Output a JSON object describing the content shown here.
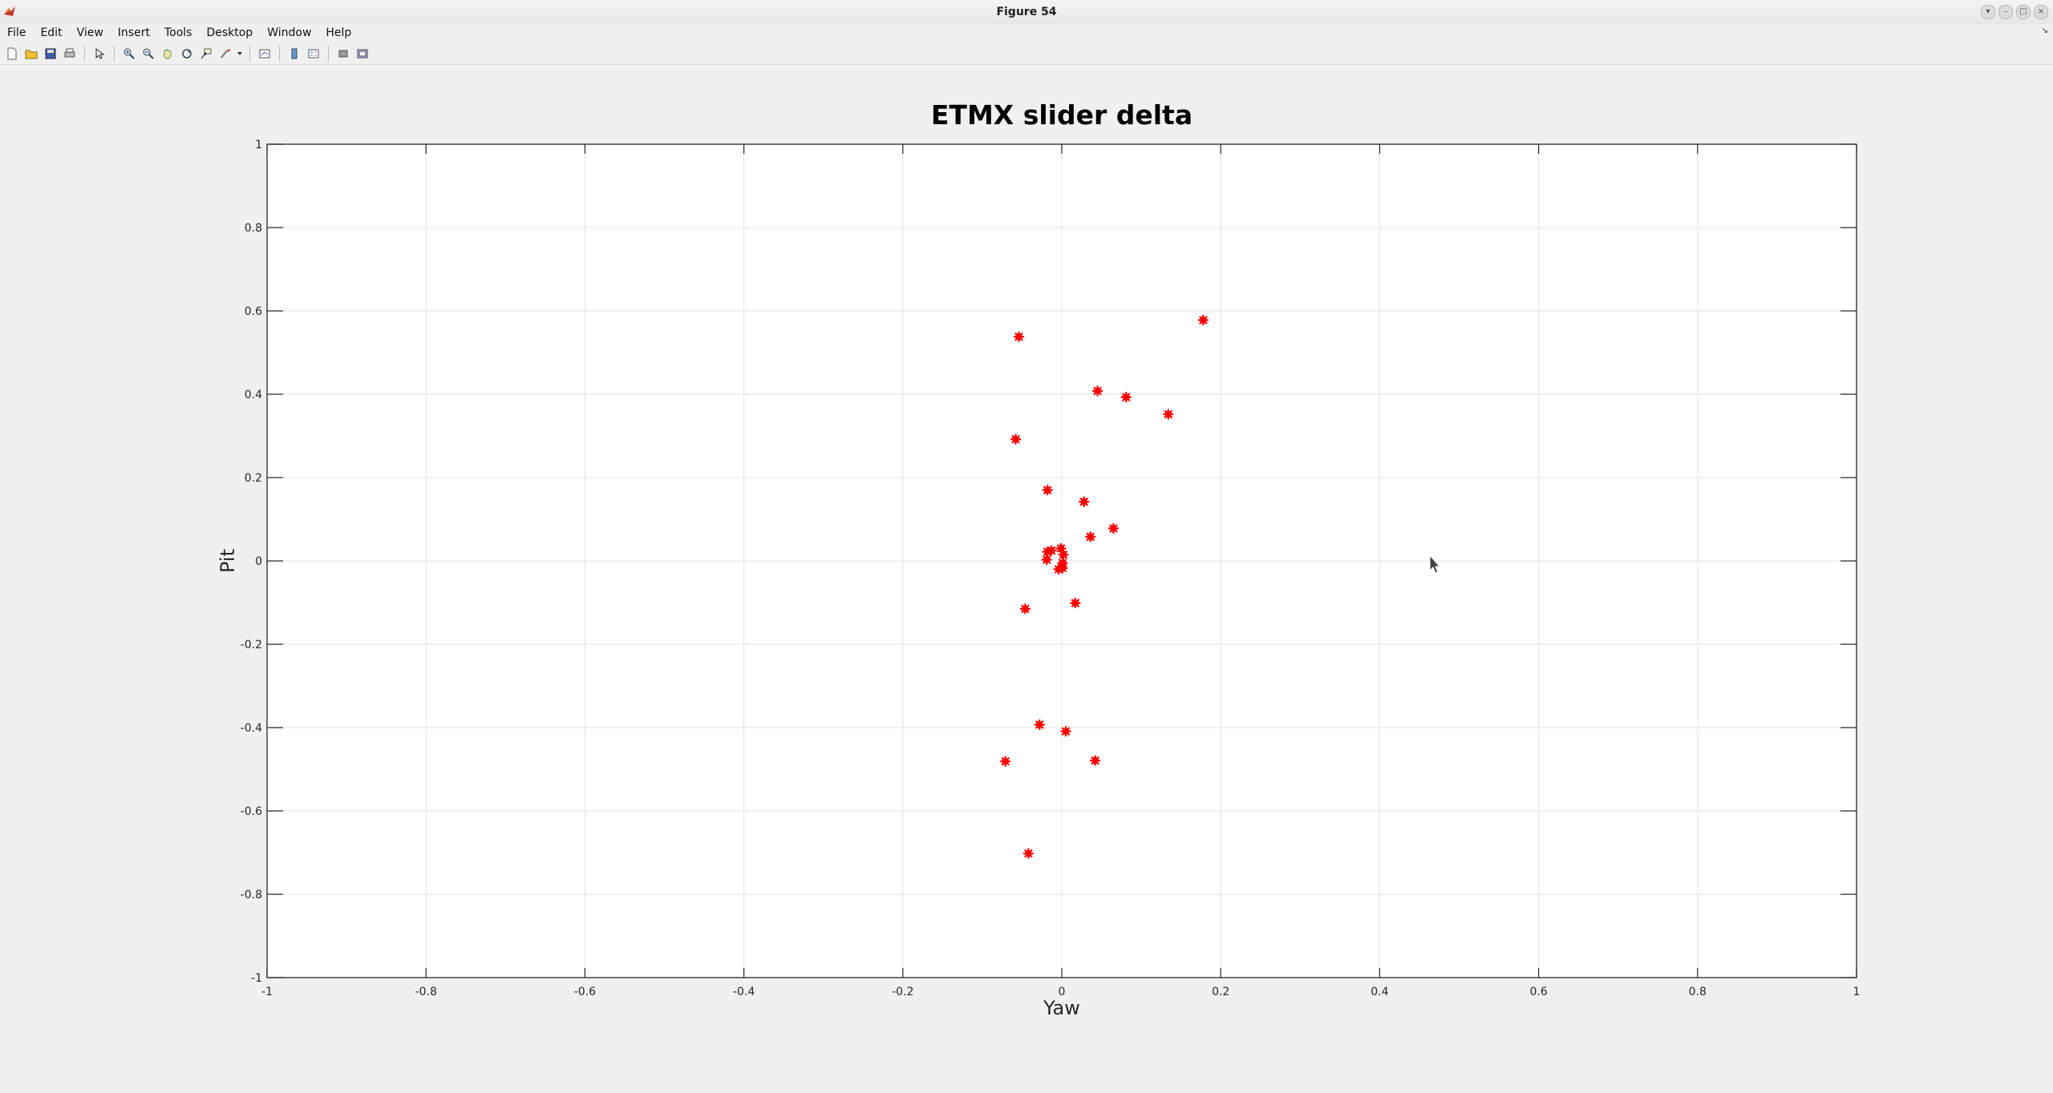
{
  "window": {
    "title": "Figure 54"
  },
  "menu": {
    "items": [
      "File",
      "Edit",
      "View",
      "Insert",
      "Tools",
      "Desktop",
      "Window",
      "Help"
    ]
  },
  "toolbar": {
    "buttons": [
      "new-figure-icon",
      "open-file-icon",
      "save-icon",
      "print-icon",
      "|",
      "edit-plot-arrow-icon",
      "|",
      "zoom-in-icon",
      "zoom-out-icon",
      "pan-hand-icon",
      "rotate-3d-icon",
      "data-cursor-icon",
      "brush-icon",
      "brush-dropdown-icon",
      "|",
      "link-plot-icon",
      "|",
      "insert-colorbar-icon",
      "insert-legend-icon",
      "|",
      "hide-plot-tools-icon",
      "show-plot-tools-icon"
    ]
  },
  "colors": {
    "marker": "#ff0000",
    "axes_bg": "#ffffff",
    "figure_bg": "#f0f0f0",
    "grid": "#e3e3e3"
  },
  "chart_data": {
    "type": "scatter",
    "title": "ETMX slider delta",
    "xlabel": "Yaw",
    "ylabel": "Pit",
    "xlim": [
      -1,
      1
    ],
    "ylim": [
      -1,
      1
    ],
    "xticks": [
      -1,
      -0.8,
      -0.6,
      -0.4,
      -0.2,
      0,
      0.2,
      0.4,
      0.6,
      0.8,
      1
    ],
    "yticks": [
      -1,
      -0.8,
      -0.6,
      -0.4,
      -0.2,
      0,
      0.2,
      0.4,
      0.6,
      0.8,
      1
    ],
    "xtick_labels": [
      "-1",
      "-0.8",
      "-0.6",
      "-0.4",
      "-0.2",
      "0",
      "0.2",
      "0.4",
      "0.6",
      "0.8",
      "1"
    ],
    "ytick_labels": [
      "-1",
      "-0.8",
      "-0.6",
      "-0.4",
      "-0.2",
      "0",
      "0.2",
      "0.4",
      "0.6",
      "0.8",
      "1"
    ],
    "grid": true,
    "marker": "*",
    "color": "#ff0000",
    "points": [
      {
        "x": -0.054,
        "y": 0.538
      },
      {
        "x": 0.178,
        "y": 0.578
      },
      {
        "x": 0.045,
        "y": 0.408
      },
      {
        "x": 0.081,
        "y": 0.393
      },
      {
        "x": 0.134,
        "y": 0.352
      },
      {
        "x": -0.058,
        "y": 0.292
      },
      {
        "x": -0.018,
        "y": 0.17
      },
      {
        "x": 0.028,
        "y": 0.142
      },
      {
        "x": 0.065,
        "y": 0.078
      },
      {
        "x": 0.036,
        "y": 0.058
      },
      {
        "x": -0.018,
        "y": 0.022
      },
      {
        "x": -0.013,
        "y": 0.025
      },
      {
        "x": -0.001,
        "y": 0.03
      },
      {
        "x": 0.002,
        "y": 0.015
      },
      {
        "x": -0.019,
        "y": 0.003
      },
      {
        "x": 0.001,
        "y": -0.005
      },
      {
        "x": 0.001,
        "y": -0.017
      },
      {
        "x": -0.004,
        "y": -0.02
      },
      {
        "x": -0.046,
        "y": -0.115
      },
      {
        "x": 0.017,
        "y": -0.101
      },
      {
        "x": -0.028,
        "y": -0.393
      },
      {
        "x": 0.005,
        "y": -0.409
      },
      {
        "x": -0.071,
        "y": -0.481
      },
      {
        "x": 0.042,
        "y": -0.479
      },
      {
        "x": -0.042,
        "y": -0.702
      }
    ]
  }
}
